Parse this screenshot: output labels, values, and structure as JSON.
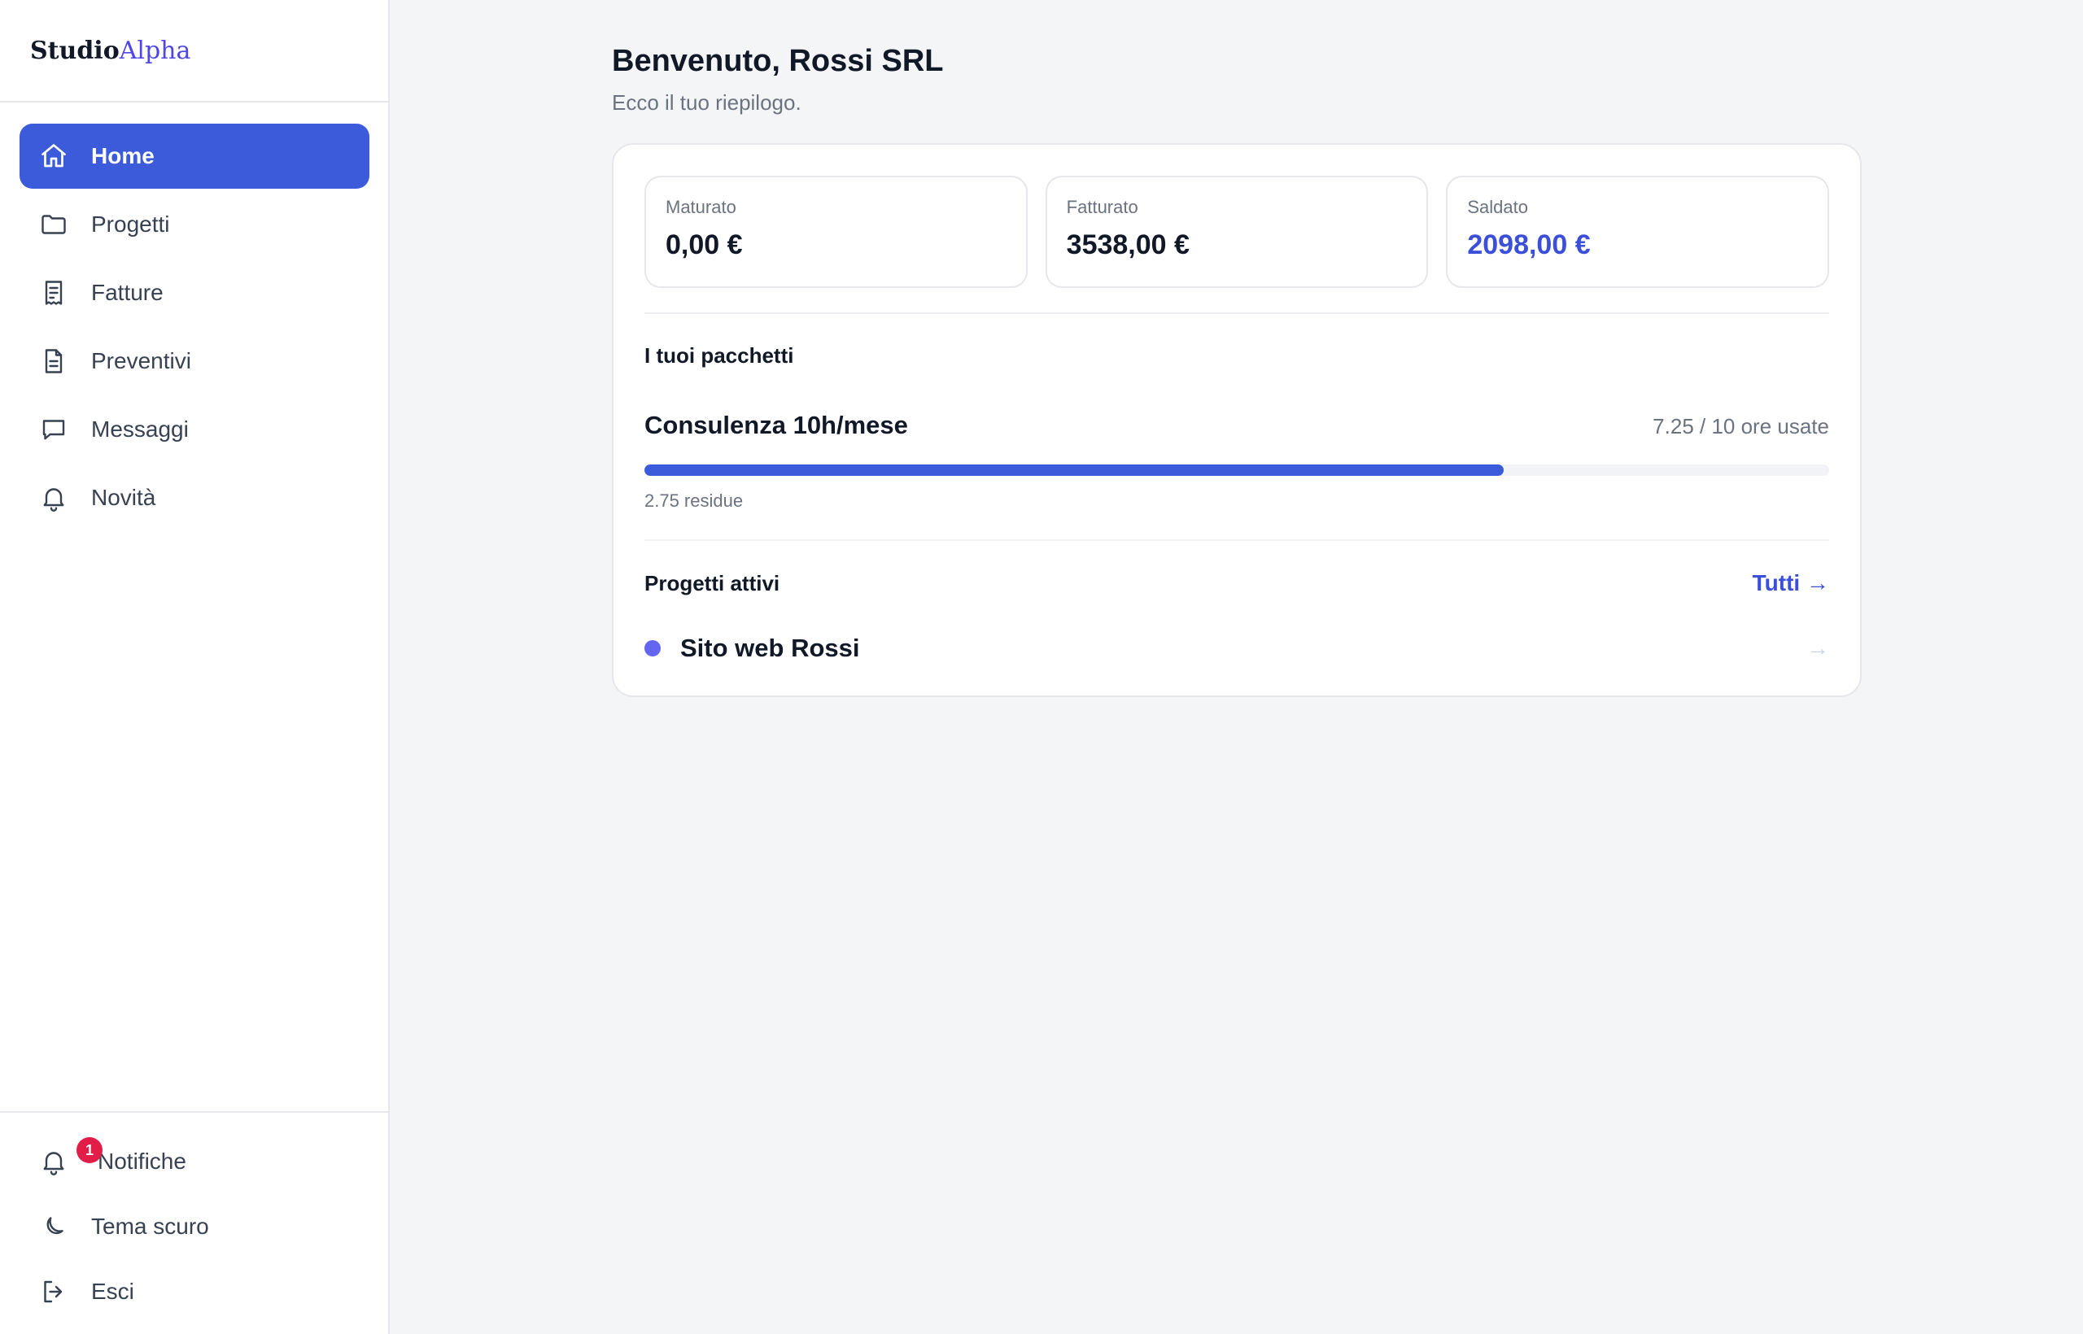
{
  "brand": {
    "part1": "Studio",
    "part2": "Alpha"
  },
  "nav": [
    {
      "label": "Home",
      "icon": "home-icon",
      "active": true
    },
    {
      "label": "Progetti",
      "icon": "folder-icon"
    },
    {
      "label": "Fatture",
      "icon": "receipt-icon"
    },
    {
      "label": "Preventivi",
      "icon": "document-icon"
    },
    {
      "label": "Messaggi",
      "icon": "chat-icon"
    },
    {
      "label": "Novità",
      "icon": "bell-icon"
    }
  ],
  "bottom": {
    "notifications": {
      "label": "Notifiche",
      "badge": "1"
    },
    "theme": {
      "label": "Tema scuro"
    },
    "logout": {
      "label": "Esci"
    }
  },
  "header": {
    "title": "Benvenuto, Rossi SRL",
    "subtitle": "Ecco il tuo riepilogo."
  },
  "stats": [
    {
      "label": "Maturato",
      "value": "0,00 €"
    },
    {
      "label": "Fatturato",
      "value": "3538,00 €"
    },
    {
      "label": "Saldato",
      "value": "2098,00 €",
      "accent_color": "#3b4fd8"
    }
  ],
  "packages": {
    "title": "I tuoi pacchetti",
    "items": [
      {
        "name": "Consulenza 10h/mese",
        "usage": "7.25 / 10 ore usate",
        "used": 7.25,
        "total": 10,
        "remaining": "2.75 residue"
      }
    ]
  },
  "projects": {
    "title": "Progetti attivi",
    "all_link": "Tutti →",
    "items": [
      {
        "name": "Sito web Rossi",
        "arrow": "→",
        "dot_color": "#6366f1"
      }
    ]
  },
  "colors": {
    "accent": "#3b5bdb",
    "background": "#f4f5f7",
    "badge": "#e11d48"
  }
}
